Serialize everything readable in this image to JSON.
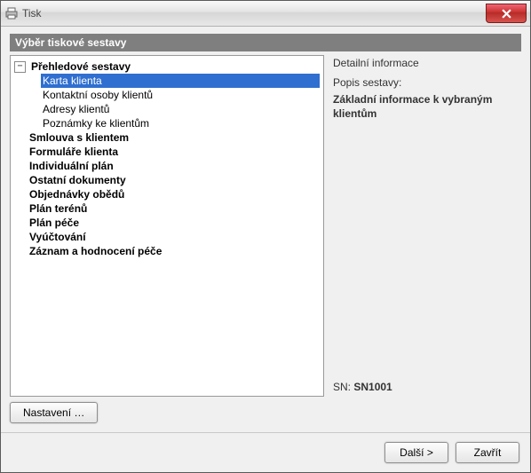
{
  "window": {
    "title": "Tisk"
  },
  "section_header": "Výběr tiskové sestavy",
  "tree": {
    "nodes": [
      {
        "label": "Přehledové sestavy",
        "bold": true,
        "expanded": true,
        "children": [
          {
            "label": "Karta klienta",
            "selected": true
          },
          {
            "label": "Kontaktní osoby klientů"
          },
          {
            "label": "Adresy klientů"
          },
          {
            "label": "Poznámky ke klientům"
          }
        ]
      },
      {
        "label": "Smlouva s klientem",
        "bold": true,
        "expanded": false
      },
      {
        "label": "Formuláře klienta",
        "bold": true,
        "expanded": false
      },
      {
        "label": "Individuální plán",
        "bold": true,
        "expanded": false
      },
      {
        "label": "Ostatní dokumenty",
        "bold": true,
        "expanded": false
      },
      {
        "label": "Objednávky obědů",
        "bold": true,
        "expanded": false
      },
      {
        "label": "Plán terénů",
        "bold": true,
        "expanded": false
      },
      {
        "label": "Plán péče",
        "bold": true,
        "expanded": false
      },
      {
        "label": "Vyúčtování",
        "bold": true,
        "expanded": false
      },
      {
        "label": "Záznam a hodnocení péče",
        "bold": true,
        "expanded": false
      }
    ]
  },
  "detail": {
    "title": "Detailní informace",
    "caption": "Popis sestavy:",
    "description": "Základní informace k vybraným klientům",
    "sn_label": "SN:",
    "sn_value": "SN1001"
  },
  "buttons": {
    "settings": "Nastavení …",
    "next": "Další >",
    "close": "Zavřít"
  }
}
